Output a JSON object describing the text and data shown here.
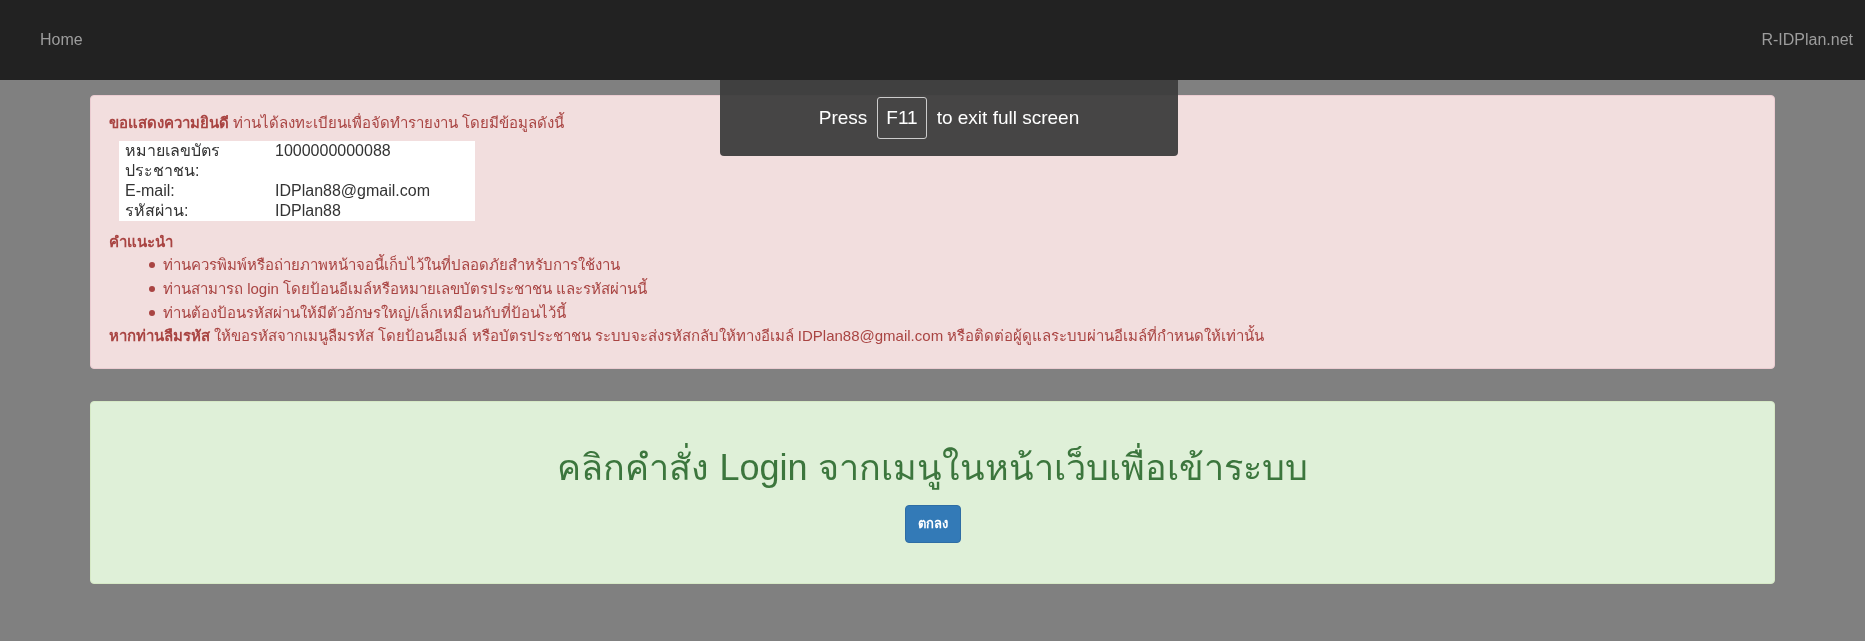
{
  "navbar": {
    "home": "Home",
    "brand": "R-IDPlan.net"
  },
  "fullscreen_notice": {
    "before": "Press",
    "key": "F11",
    "after": "to exit full screen"
  },
  "alert": {
    "intro": "**ขอแสดงความยินดี** ท่านได้ลงทะเบียนเพื่อจัดทำรายงาน โดยมีข้อมูลดังนี้",
    "info": [
      {
        "label": "หมายเลขบัตรประชาชน:",
        "value": "1000000000088"
      },
      {
        "label": "E-mail:",
        "value": "IDPlan88@gmail.com"
      },
      {
        "label": "รหัสผ่าน:",
        "value": "IDPlan88"
      }
    ],
    "advice_title": "คำแนะนำ",
    "advice": [
      "ท่านควรพิมพ์หรือถ่ายภาพหน้าจอนี้เก็บไว้ในที่ปลอดภัยสำหรับการใช้งาน",
      "ท่านสามารถ login โดยป้อนอีเมล์หรือหมายเลขบัตรประชาชน และรหัสผ่านนี้",
      "ท่านต้องป้อนรหัสผ่านให้มีตัวอักษรใหญ่/เล็กเหมือนกับที่ป้อนไว้นี้"
    ],
    "forgot": "**หากท่านลืมรหัส** ให้ขอรหัสจากเมนูลืมรหัส โดยป้อนอีเมล์ หรือบัตรประชาชน ระบบจะส่งรหัสกลับให้ทางอีเมล์ IDPlan88@gmail.com หรือติดต่อผู้ดูแลระบบผ่านอีเมล์ที่กำหนดให้เท่านั้น"
  },
  "success": {
    "heading": "คลิกคำสั่ง Login จากเมนูในหน้าเว็บเพื่อเข้าระบบ",
    "button": "ตกลง"
  }
}
